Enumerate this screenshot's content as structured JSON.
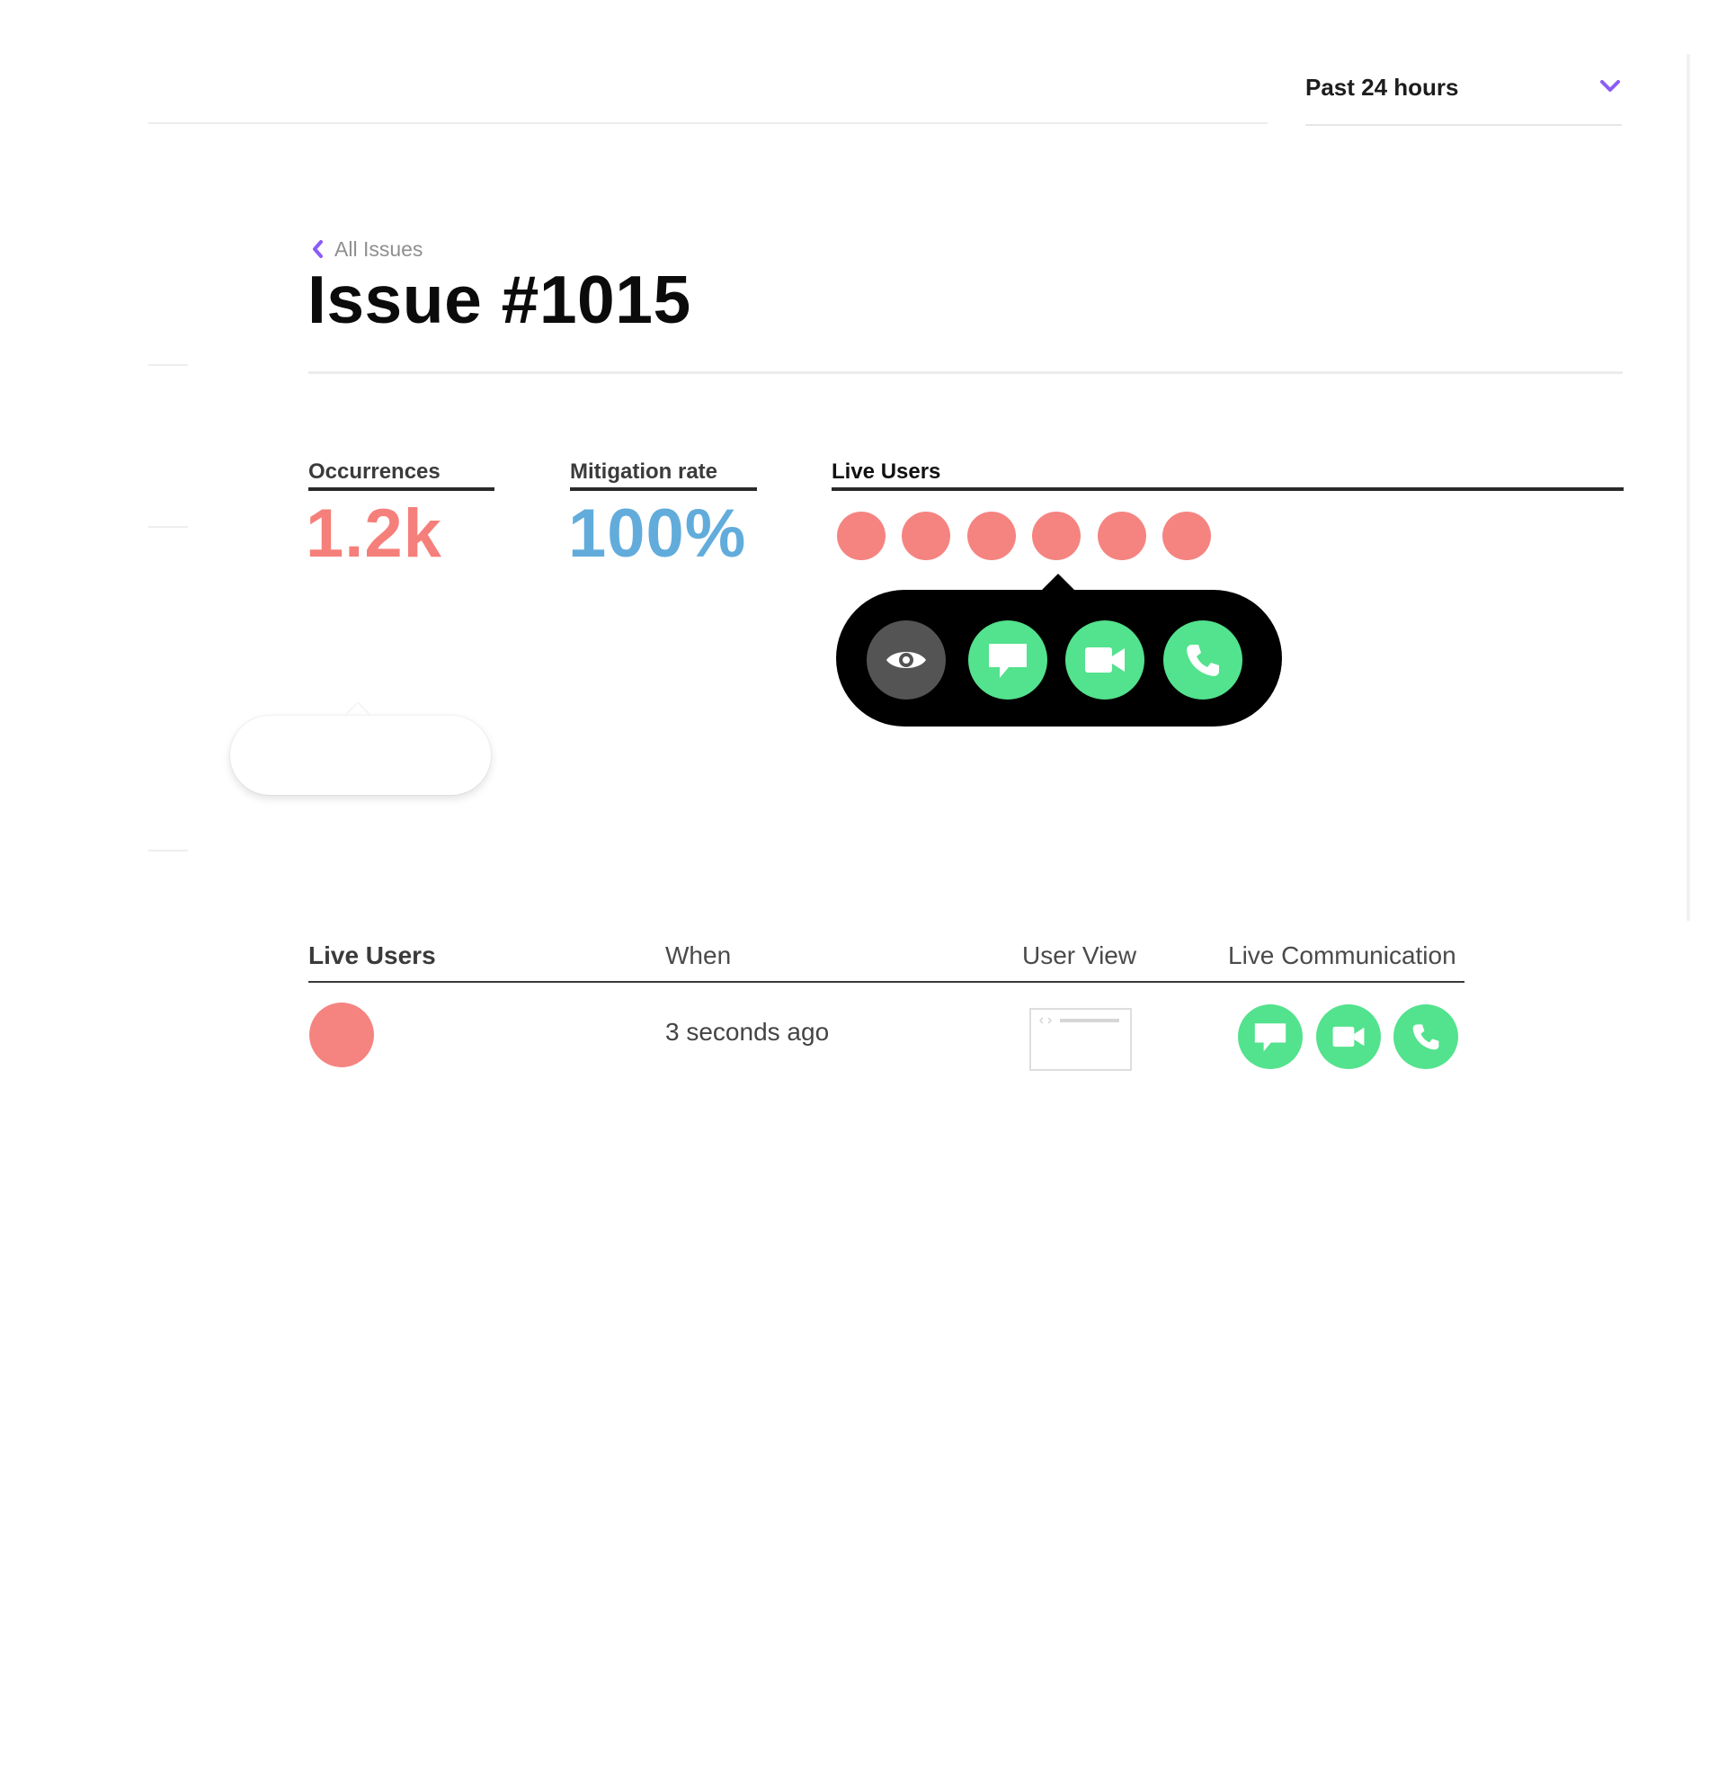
{
  "header": {
    "time_range": "Past 24 hours",
    "time_range_icon": "chevron-down-icon",
    "accent_color": "#8b5cf6"
  },
  "breadcrumb": {
    "label": "All Issues",
    "icon": "chevron-left-icon"
  },
  "issue": {
    "title": "Issue #1015"
  },
  "stats": {
    "occurrences": {
      "label": "Occurrences",
      "value": "1.2k",
      "color": "#f57f7a"
    },
    "mitigation": {
      "label": "Mitigation rate",
      "value": "100%",
      "color": "#62acdc"
    },
    "live_users": {
      "label": "Live Users",
      "count": 6,
      "dot_color": "#f58481"
    }
  },
  "popover": {
    "actions": [
      "eye-icon",
      "chat-icon",
      "video-icon",
      "phone-icon"
    ]
  },
  "table": {
    "headers": {
      "users": "Live Users",
      "when": "When",
      "view": "User View",
      "comm": "Live Communication"
    },
    "rows": [
      {
        "when": "3 seconds ago",
        "actions": [
          "chat-icon",
          "video-icon",
          "phone-icon"
        ]
      }
    ]
  },
  "colors": {
    "green": "#53e28d",
    "avatar": "#f58481",
    "dark": "#000000"
  }
}
